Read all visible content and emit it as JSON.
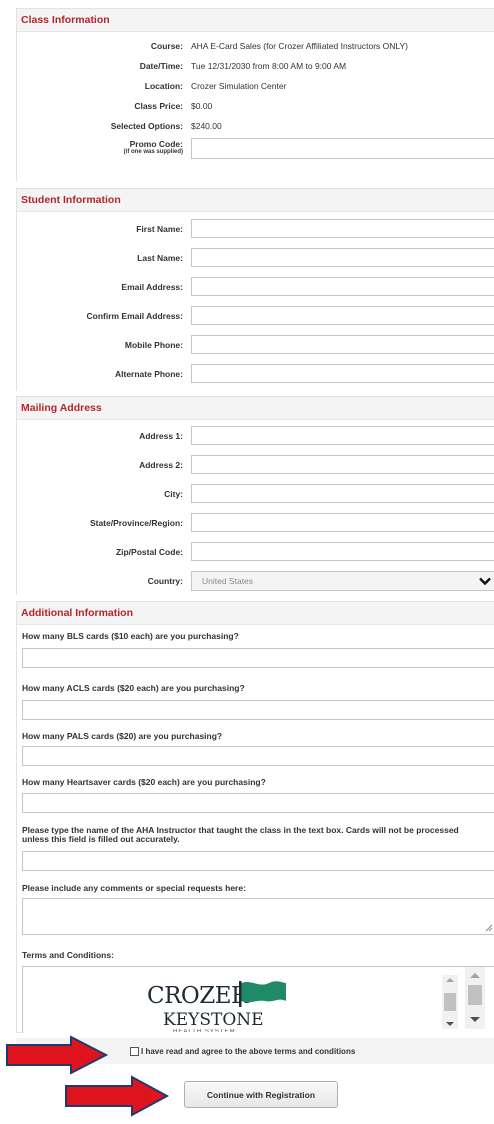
{
  "class_info": {
    "heading": "Class Information",
    "course_label": "Course:",
    "course_value": "AHA E-Card Sales (for Crozer Affiliated Instructors ONLY)",
    "datetime_label": "Date/Time:",
    "datetime_value": "Tue 12/31/2030 from 8:00 AM to 9:00 AM",
    "location_label": "Location:",
    "location_value": "Crozer Simulation Center",
    "price_label": "Class Price:",
    "price_value": "$0.00",
    "options_label": "Selected Options:",
    "options_value": "$240.00",
    "promo_label": "Promo Code:",
    "promo_sub": "(if one was supplied)"
  },
  "student_info": {
    "heading": "Student Information",
    "first_name": "First Name:",
    "last_name": "Last Name:",
    "email": "Email Address:",
    "confirm_email": "Confirm Email Address:",
    "mobile": "Mobile Phone:",
    "alternate": "Alternate Phone:"
  },
  "mailing": {
    "heading": "Mailing Address",
    "address1": "Address 1:",
    "address2": "Address 2:",
    "city": "City:",
    "state": "State/Province/Region:",
    "zip": "Zip/Postal Code:",
    "country": "Country:",
    "country_value": "United States"
  },
  "additional": {
    "heading": "Additional Information",
    "q_bls": "How many BLS cards ($10 each) are you purchasing?",
    "q_acls": "How many ACLS cards ($20 each) are you purchasing?",
    "q_pals": "How many PALS cards ($20) are you purchasing?",
    "q_heartsaver": "How many Heartsaver cards ($20 each) are you purchasing?",
    "q_instructor": "Please type the name of the AHA Instructor that taught the class in the text box. Cards will not be processed unless this field is filled out accurately.",
    "q_comments": "Please include any comments or special requests here:",
    "terms_label": "Terms and Conditions:",
    "logo_line1": "CROZER",
    "logo_line2": "KEYSTONE",
    "logo_line3": "HEALTH SYSTEM",
    "agree_label": "I have read and agree to the above terms and conditions",
    "continue_label": "Continue with Registration"
  },
  "colors": {
    "heading_red": "#b2262c",
    "arrow_red": "#e0141e",
    "flag_green": "#1e8a68"
  }
}
